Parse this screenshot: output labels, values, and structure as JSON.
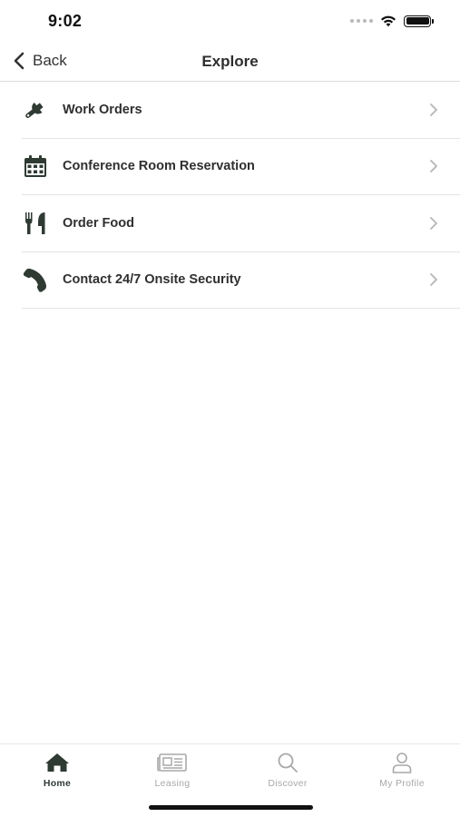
{
  "status": {
    "time": "9:02"
  },
  "nav": {
    "back_label": "Back",
    "title": "Explore"
  },
  "menu": [
    {
      "label": "Work Orders",
      "icon": "wrench-icon"
    },
    {
      "label": "Conference Room Reservation",
      "icon": "calendar-icon"
    },
    {
      "label": "Order Food",
      "icon": "utensils-icon"
    },
    {
      "label": "Contact 24/7 Onsite Security",
      "icon": "phone-icon"
    }
  ],
  "tabs": [
    {
      "label": "Home",
      "icon": "home-icon",
      "active": true
    },
    {
      "label": "Leasing",
      "icon": "newspaper-icon",
      "active": false
    },
    {
      "label": "Discover",
      "icon": "search-icon",
      "active": false
    },
    {
      "label": "My Profile",
      "icon": "user-icon",
      "active": false
    }
  ],
  "colors": {
    "icon_dark": "#2f3a33",
    "text": "#2f2f2f",
    "inactive": "#a8a8a8",
    "divider": "#e4e4e4"
  }
}
